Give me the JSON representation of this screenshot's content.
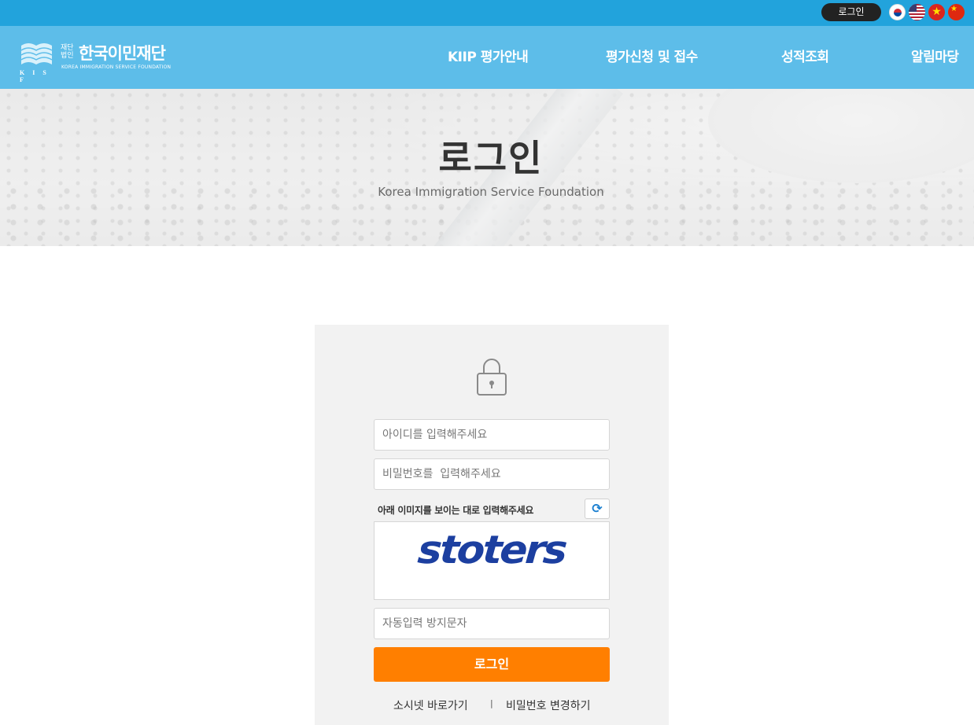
{
  "topbar": {
    "login_label": "로그인",
    "languages": [
      "korean-flag",
      "us-flag",
      "vietnam-flag",
      "china-flag"
    ]
  },
  "logo": {
    "mark_text": "K I S F",
    "small_text": "재단 법인",
    "title": "한국이민재단",
    "subtitle": "KOREA IMMIGRATION SERVICE FOUNDATION"
  },
  "nav": {
    "items": [
      {
        "label": "KIIP 평가안내"
      },
      {
        "label": "평가신청 및 접수"
      },
      {
        "label": "성적조회"
      },
      {
        "label": "알림마당"
      }
    ]
  },
  "hero": {
    "title": "로그인",
    "subtitle": "Korea Immigration Service Foundation"
  },
  "login": {
    "id_placeholder": "아이디를 입력해주세요",
    "password_placeholder": "비밀번호를  입력해주세요",
    "captcha_label": "아래 이미지를 보이는 대로 입력해주세요",
    "captcha_text": "stoters",
    "captcha_placeholder": "자동입력 방지문자",
    "submit_label": "로그인",
    "social_link": "소시넷 바로가기",
    "separator": "|",
    "change_password_link": "비밀번호 변경하기"
  },
  "colors": {
    "topbar": "#22a3dc",
    "navbar": "#5dbde9",
    "login_button": "#ff7f00",
    "panel": "#f2f2f2"
  }
}
